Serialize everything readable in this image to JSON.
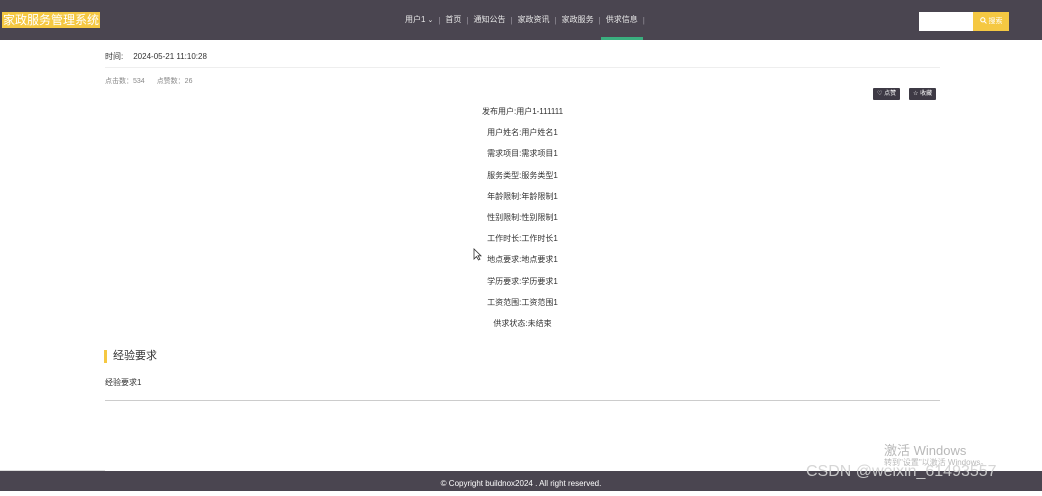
{
  "header": {
    "logo": "家政服务管理系统",
    "nav": [
      {
        "label": "用户1"
      },
      {
        "label": "首页"
      },
      {
        "label": "通知公告"
      },
      {
        "label": "家政资讯"
      },
      {
        "label": "家政服务"
      },
      {
        "label": "供求信息",
        "active": true
      }
    ],
    "search": {
      "value": "",
      "placeholder": "",
      "button_label": "搜索",
      "icon": "search-icon"
    }
  },
  "meta": {
    "time_label": "时间:",
    "time_value": "2024-05-21 11:10:28",
    "clicks": "点击数：534",
    "likes": "点赞数：26"
  },
  "actions": {
    "like_label": "点赞",
    "favorite_label": "收藏"
  },
  "details": [
    "发布用户:用户1-111111",
    "用户姓名:用户姓名1",
    "需求项目:需求项目1",
    "服务类型:服务类型1",
    "年龄限制:年龄限制1",
    "性别限制:性别限制1",
    "工作时长:工作时长1",
    "地点要求:地点要求1",
    "学历要求:学历要求1",
    "工资范围:工资范围1",
    "供求状态:未结束"
  ],
  "section": {
    "title": "经验要求",
    "content": "经验要求1"
  },
  "footer": {
    "copyright": "© Copyright buildnox2024 . All right reserved."
  },
  "overlay": {
    "activate_title": "激活 Windows",
    "activate_sub": "转到\"设置\"以激活 Windows。",
    "csdn": "CSDN @weixin_61493557"
  },
  "colors": {
    "header_bg": "#4a4550",
    "accent": "#f5c842",
    "active_underline": "#3aaf7f"
  }
}
